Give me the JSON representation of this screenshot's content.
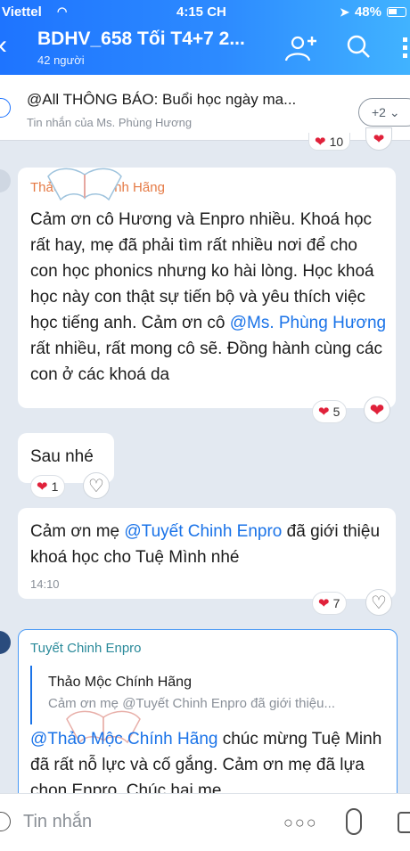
{
  "status": {
    "carrier": "Viettel",
    "time": "4:15 CH",
    "battery": "48%"
  },
  "header": {
    "title": "BDHV_658 Tối T4+7 2...",
    "members": "42 người"
  },
  "pinned": {
    "title": "@All THÔNG BÁO: Buổi học ngày ma...",
    "subtitle": "Tin nhắn của Ms. Phùng Hương",
    "count": "+2"
  },
  "messages": {
    "m1": {
      "sender": "Thảo Mộc  Chính Hãng",
      "text_a": "Cảm ơn cô Hương và Enpro nhiều. Khoá học rất hay, mẹ đã phải tìm rất nhiều nơi để cho con học phonics nhưng ko hài lòng. Học khoá học này con thật sự tiến bộ và yêu thích việc học tiếng anh. Cảm ơn cô ",
      "mention": "@Ms. Phùng Hương",
      "text_b": " rất nhiều, rất mong cô sẽ. Đồng hành cùng các con ở các khoá da",
      "reactions": "5"
    },
    "m2": {
      "text": "Sau nhé",
      "reactions": "1"
    },
    "m3": {
      "text_a": "Cảm ơn mẹ ",
      "mention": "@Tuyết Chinh Enpro",
      "text_b": " đã giới thiệu khoá học cho Tuệ Mình nhé",
      "time": "14:10",
      "reactions": "7"
    },
    "m4": {
      "sender": "Tuyết Chinh Enpro",
      "quote_name": "Thảo Mộc  Chính Hãng",
      "quote_text": "Cảm ơn mẹ @Tuyết Chinh Enpro đã giới thiệu...",
      "mention": "@Thảo Mộc  Chính Hãng",
      "text_b": " chúc mừng Tuệ Minh đã rất nỗ lực và cố gắng. Cảm ơn mẹ đã lựa chọn Enpro. Chúc hai mẹ"
    },
    "prev_reactions": "10"
  },
  "input": {
    "placeholder": "Tin nhắn"
  },
  "colors": {
    "header_start": "#1e74ff",
    "header_end": "#41b3ff",
    "accent": "#1a73e8",
    "heart": "#e0213a"
  }
}
